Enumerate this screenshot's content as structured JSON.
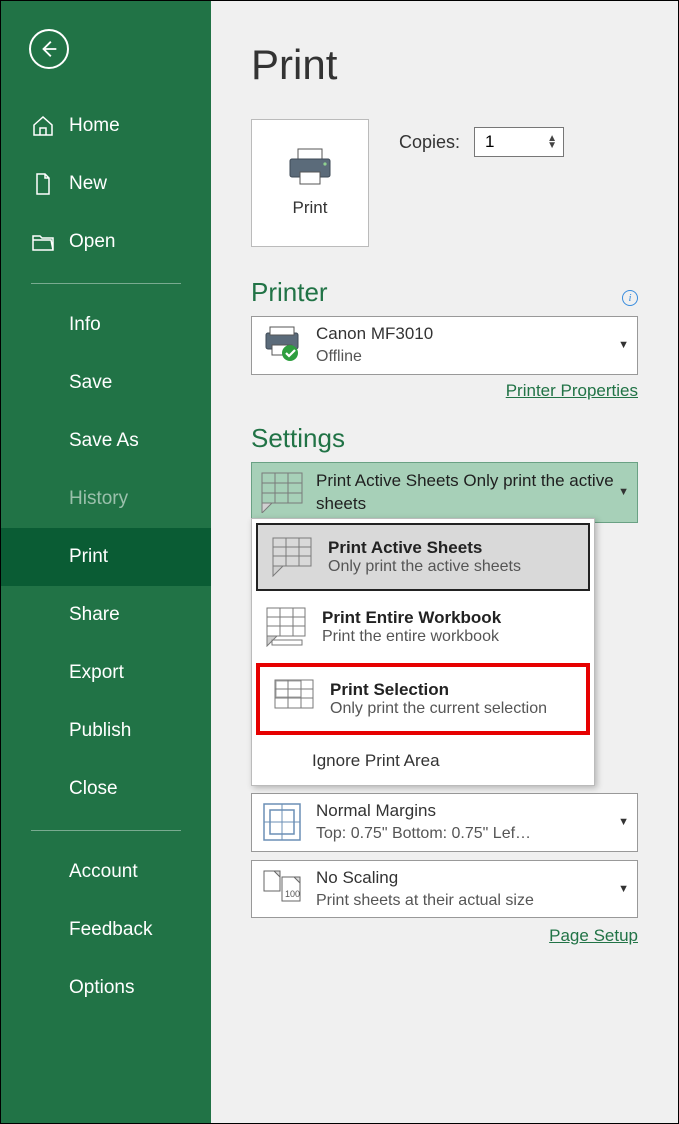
{
  "sidebar": {
    "items": [
      {
        "label": "Home"
      },
      {
        "label": "New"
      },
      {
        "label": "Open"
      },
      {
        "label": "Info"
      },
      {
        "label": "Save"
      },
      {
        "label": "Save As"
      },
      {
        "label": "History"
      },
      {
        "label": "Print"
      },
      {
        "label": "Share"
      },
      {
        "label": "Export"
      },
      {
        "label": "Publish"
      },
      {
        "label": "Close"
      },
      {
        "label": "Account"
      },
      {
        "label": "Feedback"
      },
      {
        "label": "Options"
      }
    ]
  },
  "page": {
    "title": "Print",
    "print_button": "Print",
    "copies_label": "Copies:",
    "copies_value": "1"
  },
  "printer": {
    "section_title": "Printer",
    "name": "Canon MF3010",
    "status": "Offline",
    "properties_link": "Printer Properties"
  },
  "settings": {
    "section_title": "Settings",
    "current": {
      "l1": "Print Active Sheets",
      "l2": "Only print the active sheets"
    },
    "options": [
      {
        "t1": "Print Active Sheets",
        "t2": "Only print the active sheets"
      },
      {
        "t1": "Print Entire Workbook",
        "t2": "Print the entire workbook"
      },
      {
        "t1": "Print Selection",
        "t2": "Only print the current selection"
      }
    ],
    "ignore_area": "Ignore Print Area",
    "margins": {
      "l1": "Normal Margins",
      "l2": "Top: 0.75\" Bottom: 0.75\" Lef…"
    },
    "scaling": {
      "l1": "No Scaling",
      "l2": "Print sheets at their actual size"
    },
    "page_setup_link": "Page Setup"
  }
}
